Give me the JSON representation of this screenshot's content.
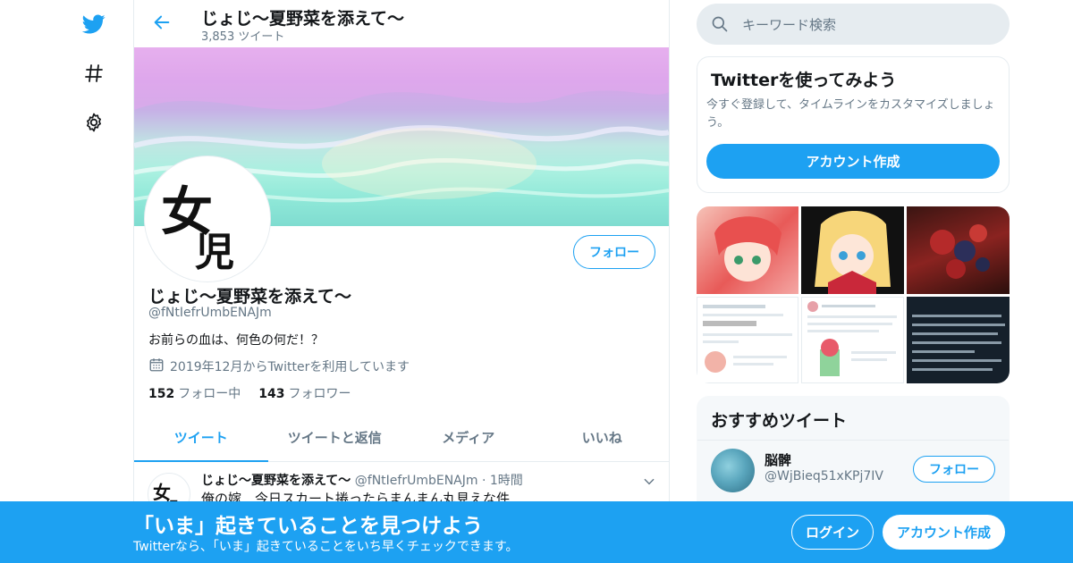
{
  "nav": {
    "items": [
      {
        "icon": "twitter-logo-icon"
      },
      {
        "icon": "hashtag-icon"
      },
      {
        "icon": "gear-icon"
      }
    ]
  },
  "header": {
    "title": "じょじ～夏野菜を添えて～",
    "tweet_count": "3,853 ツイート"
  },
  "profile": {
    "name": "じょじ～夏野菜を添えて～",
    "handle": "@fNtIefrUmbENAJm",
    "bio": "お前らの血は、何色の何だ！？",
    "joined": "2019年12月からTwitterを利用しています",
    "following_count": "152",
    "following_label": "フォロー中",
    "followers_count": "143",
    "followers_label": "フォロワー",
    "follow_label": "フォロー",
    "avatar_glyph": "女",
    "avatar_glyph2": "児"
  },
  "tabs": [
    {
      "label": "ツイート",
      "active": true
    },
    {
      "label": "ツイートと返信",
      "active": false
    },
    {
      "label": "メディア",
      "active": false
    },
    {
      "label": "いいね",
      "active": false
    }
  ],
  "tweet": {
    "name": "じょじ～夏野菜を添えて～",
    "handle": "@fNtIefrUmbENAJm",
    "time": "1時間",
    "text": "俺の嫁　今日スカート捲ったらまんまん丸見えな件"
  },
  "search": {
    "placeholder": "キーワード検索"
  },
  "signup_card": {
    "title": "Twitterを使ってみよう",
    "desc": "今すぐ登録して、タイムラインをカスタマイズしましょう。",
    "button": "アカウント作成"
  },
  "recommend": {
    "title": "おすすめツイート",
    "user": {
      "name": "脳髀",
      "handle": "@WjBieq51xKPj7IV",
      "follow_label": "フォロー"
    }
  },
  "bottom_bar": {
    "title": "「いま」起きていることを見つけよう",
    "subtitle": "Twitterなら、「いま」起きていることをいち早くチェックできます。",
    "login": "ログイン",
    "signup": "アカウント作成"
  },
  "colors": {
    "accent": "#1da1f2",
    "muted": "#657786",
    "border": "#e6ecf0"
  }
}
